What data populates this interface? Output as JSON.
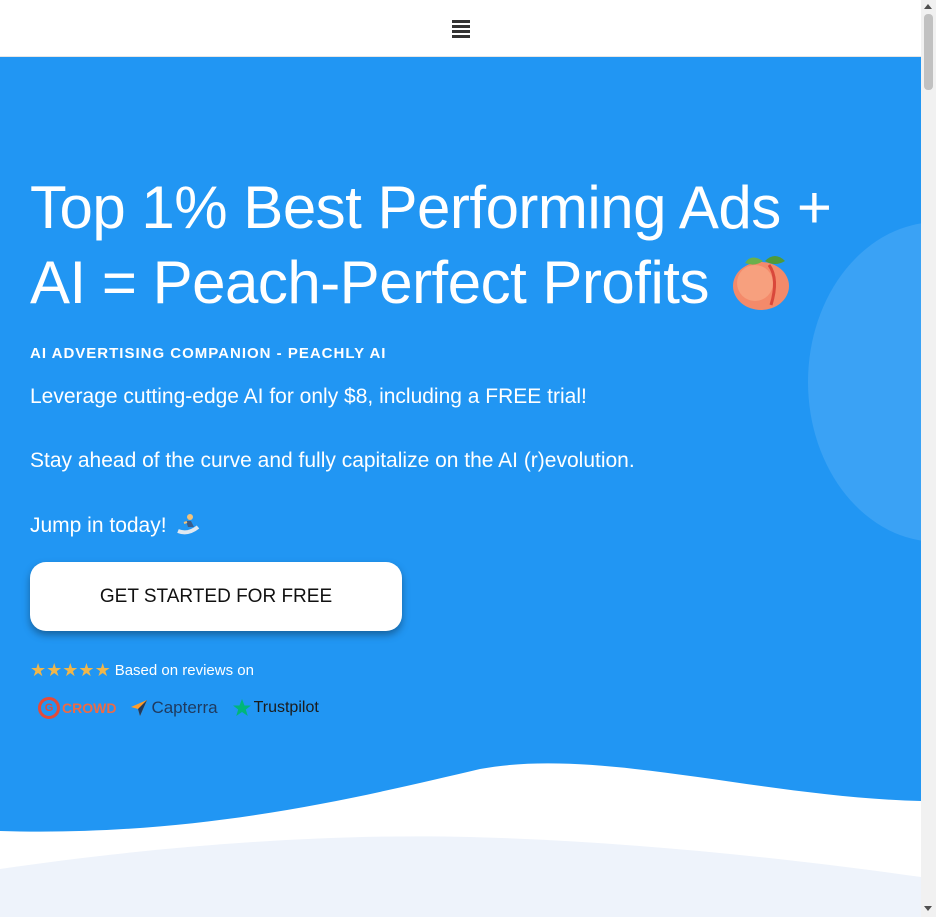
{
  "nav": {
    "menu_icon": "hamburger-menu-icon"
  },
  "hero": {
    "headline": "Top 1% Best Performing Ads + AI = Peach-Perfect Profits",
    "headline_emoji": "peach-emoji-icon",
    "eyebrow": "AI ADVERTISING COMPANION - PEACHLY AI",
    "paragraphs": [
      "Leverage cutting-edge AI for only $8, including a FREE trial!",
      "Stay ahead of the curve and fully capitalize on the AI (r)evolution.",
      "Jump in today!"
    ],
    "jump_emoji": "surfer-emoji-icon",
    "cta_label": "GET STARTED FOR FREE",
    "rating_stars": 5,
    "reviews_text": "Based on reviews on",
    "review_sites": [
      {
        "name": "G2 CROWD",
        "badge": "G",
        "word": "CROWD"
      },
      {
        "name": "Capterra",
        "word": "Capterra"
      },
      {
        "name": "Trustpilot",
        "word": "Trustpilot"
      }
    ]
  },
  "colors": {
    "hero_bg": "#2196f3",
    "cta_bg": "#ffffff",
    "star": "#f0b64a",
    "wave_light": "#eef3fb"
  }
}
